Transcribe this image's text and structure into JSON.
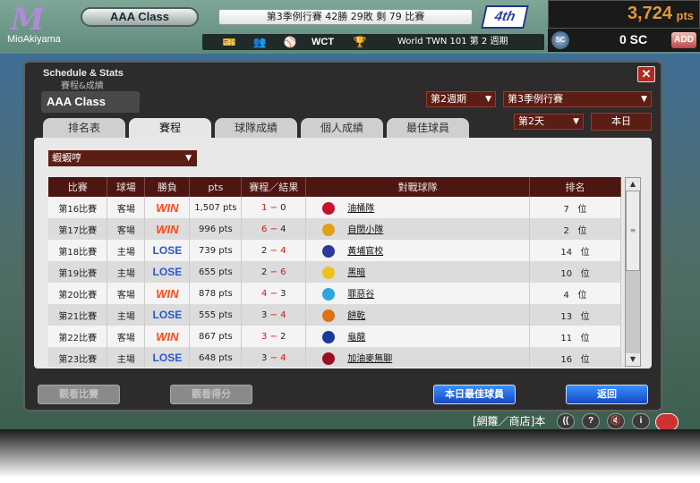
{
  "topbar": {
    "logo": "M",
    "username": "MioAkiyama",
    "class_label": "AAA Class",
    "season_status": "第3季例行賽 42勝 29敗 剩 79 比賽",
    "rank": "4th",
    "wct_label": "WCT",
    "world_label": "World TWN 101 第 2 週期",
    "points": "3,724",
    "points_unit": "pts",
    "sc_label": "SC",
    "sc_value": "0 SC",
    "add_label": "ADD"
  },
  "dialog": {
    "title": "Schedule & Stats",
    "subtitle": "賽程&成績",
    "close": "✕",
    "class_label": "AAA Class",
    "period_select": "第2週期",
    "season_select": "第3季例行賽",
    "day_select": "第2天",
    "today_button": "本日",
    "tabs": [
      "排名表",
      "賽程",
      "球隊成績",
      "個人成績",
      "最佳球員"
    ],
    "active_tab": "賽程",
    "filter_select": "蝦蝦哼",
    "columns": [
      "比賽",
      "球場",
      "勝負",
      "pts",
      "賽程／結果",
      "對戰球隊",
      "排名"
    ],
    "rows": [
      {
        "game": "第16比賽",
        "venue": "客場",
        "result": "WIN",
        "pts": "1,507 pts",
        "score_a": "1",
        "score_b": "0",
        "a_red": true,
        "b_red": false,
        "opponent": "油桶隊",
        "opp_color": "#c8102e",
        "rank": "7",
        "rank_unit": "位"
      },
      {
        "game": "第17比賽",
        "venue": "客場",
        "result": "WIN",
        "pts": "996 pts",
        "score_a": "6",
        "score_b": "4",
        "a_red": true,
        "b_red": false,
        "opponent": "自閉小隊",
        "opp_color": "#e0a01a",
        "rank": "2",
        "rank_unit": "位"
      },
      {
        "game": "第18比賽",
        "venue": "主場",
        "result": "LOSE",
        "pts": "739 pts",
        "score_a": "2",
        "score_b": "4",
        "a_red": false,
        "b_red": true,
        "opponent": "黃埔官校",
        "opp_color": "#2d3a9a",
        "rank": "14",
        "rank_unit": "位"
      },
      {
        "game": "第19比賽",
        "venue": "主場",
        "result": "LOSE",
        "pts": "655 pts",
        "score_a": "2",
        "score_b": "6",
        "a_red": false,
        "b_red": true,
        "opponent": "黑暗",
        "opp_color": "#f0c020",
        "rank": "10",
        "rank_unit": "位"
      },
      {
        "game": "第20比賽",
        "venue": "客場",
        "result": "WIN",
        "pts": "878 pts",
        "score_a": "4",
        "score_b": "3",
        "a_red": true,
        "b_red": false,
        "opponent": "罪惡谷",
        "opp_color": "#2aa7e0",
        "rank": "4",
        "rank_unit": "位"
      },
      {
        "game": "第21比賽",
        "venue": "主場",
        "result": "LOSE",
        "pts": "555 pts",
        "score_a": "3",
        "score_b": "4",
        "a_red": false,
        "b_red": true,
        "opponent": "餅乾",
        "opp_color": "#e07010",
        "rank": "13",
        "rank_unit": "位"
      },
      {
        "game": "第22比賽",
        "venue": "客場",
        "result": "WIN",
        "pts": "867 pts",
        "score_a": "3",
        "score_b": "2",
        "a_red": true,
        "b_red": false,
        "opponent": "龜龍",
        "opp_color": "#1a3a9a",
        "rank": "11",
        "rank_unit": "位"
      },
      {
        "game": "第23比賽",
        "venue": "主場",
        "result": "LOSE",
        "pts": "648 pts",
        "score_a": "3",
        "score_b": "4",
        "a_red": false,
        "b_red": true,
        "opponent": "加油麥無聊",
        "opp_color": "#9a1020",
        "rank": "16",
        "rank_unit": "位"
      }
    ],
    "buttons": {
      "watch_game": "觀看比賽",
      "watch_score": "觀看得分",
      "today_best": "本日最佳球員",
      "back": "返回"
    }
  },
  "bottom": {
    "shop_link": "[網籮／商店]本",
    "nav_back": "((",
    "help": "?",
    "mute": "🔇",
    "info": "i"
  },
  "colors": {
    "accent": "#4c1612",
    "win": "#ff4a12",
    "lose": "#2f56c7",
    "points": "#e2963a"
  }
}
